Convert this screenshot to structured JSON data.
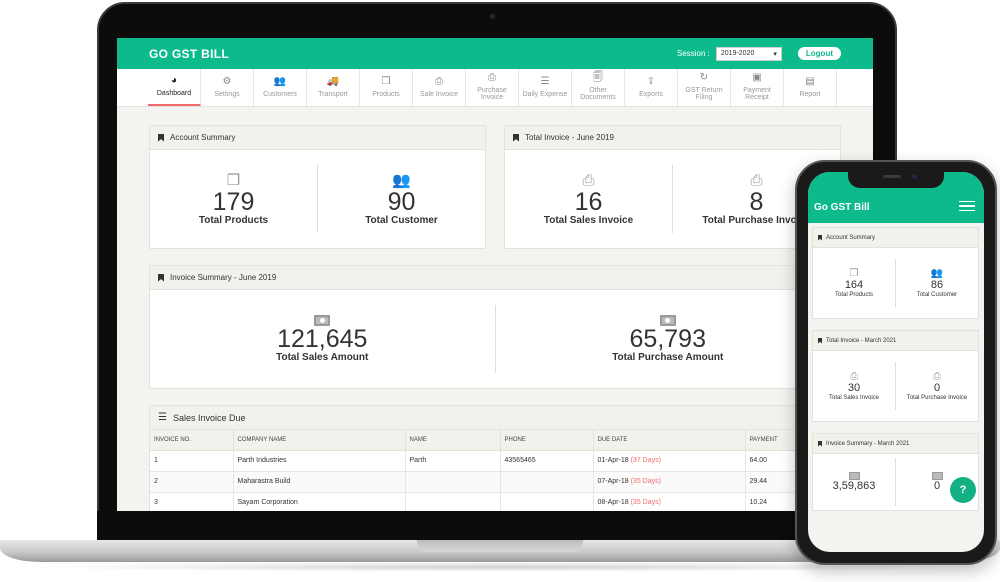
{
  "app": {
    "brand": "GO GST BILL",
    "session_label": "Session :",
    "session_value": "2019-2020",
    "logout_label": "Logout"
  },
  "nav": {
    "items": [
      {
        "label": "Dashboard",
        "icon": "dashboard-icon",
        "glyph": "◕",
        "active": true
      },
      {
        "label": "Settings",
        "icon": "gear-icon",
        "glyph": "⚙"
      },
      {
        "label": "Customers",
        "icon": "users-icon",
        "glyph": "👥"
      },
      {
        "label": "Transport",
        "icon": "truck-icon",
        "glyph": "🚚"
      },
      {
        "label": "Products",
        "icon": "cubes-icon",
        "glyph": "❒"
      },
      {
        "label": "Sale Invoice",
        "icon": "print-icon",
        "glyph": "⎙"
      },
      {
        "label": "Purchase Invoice",
        "icon": "print-icon",
        "glyph": "⎙"
      },
      {
        "label": "Daily Expense",
        "icon": "list-icon",
        "glyph": "☰"
      },
      {
        "label": "Other Documents",
        "icon": "documents-icon",
        "glyph": "🗐"
      },
      {
        "label": "Exports",
        "icon": "upload-icon",
        "glyph": "⇪"
      },
      {
        "label": "GST Return Filing",
        "icon": "refresh-icon",
        "glyph": "↻"
      },
      {
        "label": "Payment Receipt",
        "icon": "money-icon",
        "glyph": "▣"
      },
      {
        "label": "Report",
        "icon": "report-icon",
        "glyph": "▤"
      }
    ]
  },
  "account_summary": {
    "title": "Account Summary",
    "products": {
      "value": "179",
      "label": "Total Products"
    },
    "customers": {
      "value": "90",
      "label": "Total Customer"
    }
  },
  "total_invoice": {
    "title": "Total Invoice - June 2019",
    "sales": {
      "value": "16",
      "label": "Total Sales Invoice"
    },
    "purchase": {
      "value": "8",
      "label": "Total Purchase Invoice"
    }
  },
  "invoice_summary": {
    "title": "Invoice Summary - June 2019",
    "sales": {
      "value": "121,645",
      "label": "Total Sales Amount"
    },
    "purchase": {
      "value": "65,793",
      "label": "Total Purchase Amount"
    }
  },
  "sales_due": {
    "title": "Sales Invoice Due",
    "columns": [
      "INVOICE NO.",
      "COMPANY NAME",
      "NAME",
      "PHONE",
      "DUE DATE",
      "PAYMENT"
    ],
    "rows": [
      {
        "no": "1",
        "company": "Parth Industries",
        "name": "Parth",
        "phone": "43565465",
        "due": "01-Apr-18",
        "days": "(37 Days)",
        "payment": "64.00"
      },
      {
        "no": "2",
        "company": "Maharastra Build",
        "name": "",
        "phone": "",
        "due": "07-Apr-18",
        "days": "(35 Days)",
        "payment": "29.44"
      },
      {
        "no": "3",
        "company": "Sayam Corporation",
        "name": "",
        "phone": "",
        "due": "08-Apr-18",
        "days": "(35 Days)",
        "payment": "10.24"
      }
    ]
  },
  "mobile": {
    "brand": "Go GST Bill",
    "account_summary": {
      "title": "Account Summary",
      "products": {
        "value": "164",
        "label": "Total Products"
      },
      "customers": {
        "value": "86",
        "label": "Total Customer"
      }
    },
    "total_invoice": {
      "title": "Total Invoice - March 2021",
      "sales": {
        "value": "30",
        "label": "Total Sales Invoice"
      },
      "purchase": {
        "value": "0",
        "label": "Total Purchase Invoice"
      }
    },
    "invoice_summary": {
      "title": "Invoice Summary - March 2021",
      "sales": {
        "value": "3,59,863"
      },
      "purchase": {
        "value": "0"
      }
    },
    "help_label": "?"
  },
  "colors": {
    "brand": "#0dba8c",
    "due_days": "#f26b6b",
    "active_tab": "#ef6a6a"
  }
}
